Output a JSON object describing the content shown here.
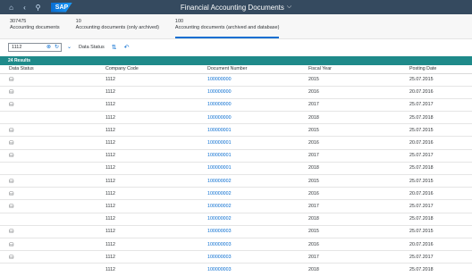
{
  "shell": {
    "title": "Financial Accounting Documents",
    "buttons": [
      {
        "name": "home-icon",
        "glyph": "⌂"
      },
      {
        "name": "back-icon",
        "glyph": "‹"
      },
      {
        "name": "search-icon",
        "glyph": "⚲"
      }
    ],
    "logo": "SAP"
  },
  "tiles": [
    {
      "count": "307475",
      "label": "Accounting documents"
    },
    {
      "count": "10",
      "label": "Accounting documents (only archived)"
    },
    {
      "count": "100",
      "label": "Accounting documents (archived and database)"
    }
  ],
  "filter": {
    "input_value": "1112",
    "data_status_label": "Data Status"
  },
  "results_label": "24 Results",
  "table": {
    "headers": [
      "Data Status",
      "Company Code",
      "Document Number",
      "Fiscal Year",
      "Posting Date"
    ],
    "rows": [
      {
        "archived": true,
        "company": "1112",
        "doc": "100000000",
        "year": "2015",
        "date": "25.07.2015"
      },
      {
        "archived": true,
        "company": "1112",
        "doc": "100000000",
        "year": "2016",
        "date": "20.07.2016"
      },
      {
        "archived": true,
        "company": "1112",
        "doc": "100000000",
        "year": "2017",
        "date": "25.07.2017"
      },
      {
        "archived": false,
        "company": "1112",
        "doc": "100000000",
        "year": "2018",
        "date": "25.07.2018"
      },
      {
        "archived": true,
        "company": "1112",
        "doc": "100000001",
        "year": "2015",
        "date": "25.07.2015"
      },
      {
        "archived": true,
        "company": "1112",
        "doc": "100000001",
        "year": "2016",
        "date": "20.07.2016"
      },
      {
        "archived": true,
        "company": "1112",
        "doc": "100000001",
        "year": "2017",
        "date": "25.07.2017"
      },
      {
        "archived": false,
        "company": "1112",
        "doc": "100000001",
        "year": "2018",
        "date": "25.07.2018"
      },
      {
        "archived": true,
        "company": "1112",
        "doc": "100000002",
        "year": "2015",
        "date": "25.07.2015"
      },
      {
        "archived": true,
        "company": "1112",
        "doc": "100000002",
        "year": "2016",
        "date": "20.07.2016"
      },
      {
        "archived": true,
        "company": "1112",
        "doc": "100000002",
        "year": "2017",
        "date": "25.07.2017"
      },
      {
        "archived": false,
        "company": "1112",
        "doc": "100000002",
        "year": "2018",
        "date": "25.07.2018"
      },
      {
        "archived": true,
        "company": "1112",
        "doc": "100000003",
        "year": "2015",
        "date": "25.07.2015"
      },
      {
        "archived": true,
        "company": "1112",
        "doc": "100000003",
        "year": "2016",
        "date": "20.07.2016"
      },
      {
        "archived": true,
        "company": "1112",
        "doc": "100000003",
        "year": "2017",
        "date": "25.07.2017"
      },
      {
        "archived": false,
        "company": "1112",
        "doc": "100000003",
        "year": "2018",
        "date": "25.07.2018"
      }
    ]
  }
}
